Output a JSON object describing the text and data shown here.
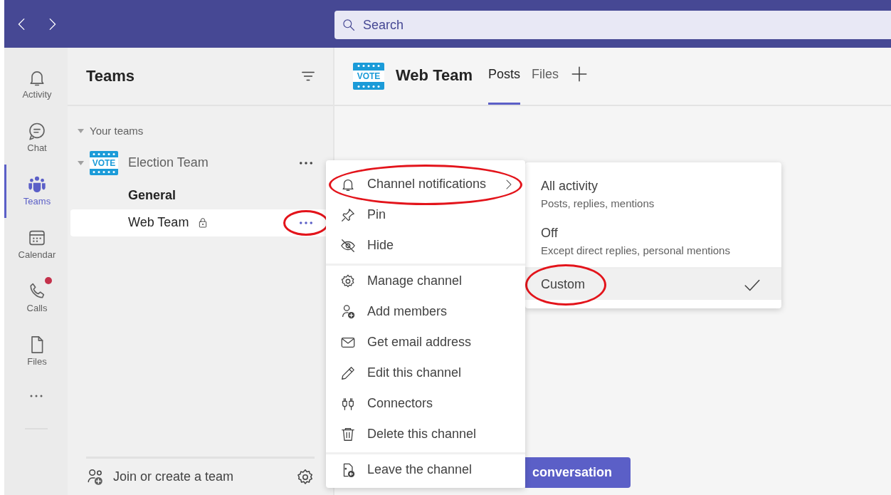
{
  "search": {
    "placeholder": "Search"
  },
  "rail": [
    {
      "label": "Activity",
      "selected": false,
      "notification": false
    },
    {
      "label": "Chat",
      "selected": false,
      "notification": false
    },
    {
      "label": "Teams",
      "selected": true,
      "notification": false
    },
    {
      "label": "Calendar",
      "selected": false,
      "notification": false
    },
    {
      "label": "Calls",
      "selected": false,
      "notification": true
    },
    {
      "label": "Files",
      "selected": false,
      "notification": false
    }
  ],
  "teams_panel": {
    "title": "Teams",
    "section": {
      "label": "Your teams",
      "expanded": true
    },
    "teams": [
      {
        "name": "Election Team",
        "logo": "VOTE",
        "expanded": true,
        "channels": [
          {
            "name": "General",
            "unread": true,
            "selected": false,
            "private": false,
            "circled": false
          },
          {
            "name": "Web Team",
            "unread": false,
            "selected": true,
            "private": true,
            "circled": true
          }
        ]
      }
    ],
    "footer": "Join or create a team"
  },
  "channel_header": {
    "logo": "VOTE",
    "title": "Web Team",
    "tabs": [
      {
        "label": "Posts",
        "selected": true
      },
      {
        "label": "Files",
        "selected": false
      }
    ]
  },
  "context_menu": {
    "groups": [
      [
        {
          "label": "Channel notifications",
          "submenu": true,
          "circled": true
        },
        {
          "label": "Pin",
          "submenu": false,
          "circled": false
        },
        {
          "label": "Hide",
          "submenu": false,
          "circled": false
        }
      ],
      [
        {
          "label": "Manage channel",
          "submenu": false,
          "circled": false
        },
        {
          "label": "Add members",
          "submenu": false,
          "circled": false
        },
        {
          "label": "Get email address",
          "submenu": false,
          "circled": false
        },
        {
          "label": "Edit this channel",
          "submenu": false,
          "circled": false
        },
        {
          "label": "Connectors",
          "submenu": false,
          "circled": false
        },
        {
          "label": "Delete this channel",
          "submenu": false,
          "circled": false
        }
      ],
      [
        {
          "label": "Leave the channel",
          "submenu": false,
          "circled": false
        }
      ]
    ]
  },
  "notification_menu": {
    "options": [
      {
        "label": "All activity",
        "description": "Posts, replies, mentions",
        "selected": false,
        "circled": false
      },
      {
        "label": "Off",
        "description": "Except direct replies, personal mentions",
        "selected": false,
        "circled": false
      },
      {
        "label": "Custom",
        "selected": true,
        "circled": true
      }
    ]
  },
  "new_conversation_button": "conversation"
}
